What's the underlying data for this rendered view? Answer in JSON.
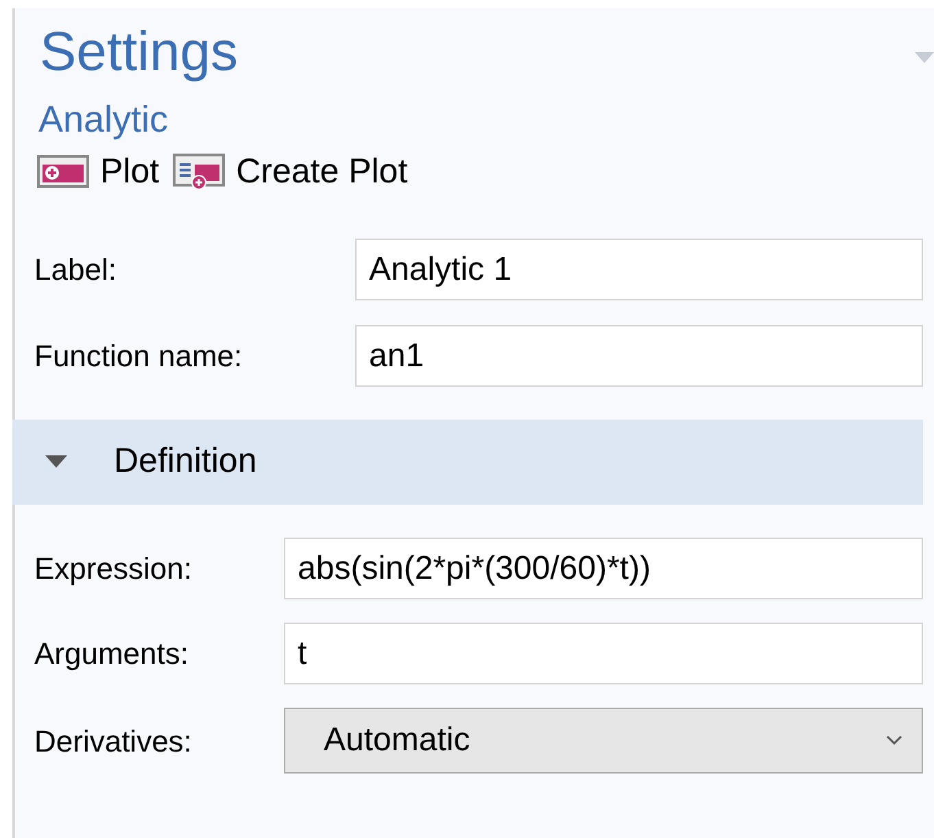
{
  "panel": {
    "title": "Settings",
    "subtitle": "Analytic"
  },
  "toolbar": [
    {
      "label": "Plot",
      "kind": "plot"
    },
    {
      "label": "Create Plot",
      "kind": "create"
    }
  ],
  "fields": [
    {
      "label": "Label:",
      "value": "Analytic 1",
      "kind": "text"
    },
    {
      "label": "Function name:",
      "value": "an1",
      "kind": "text"
    }
  ],
  "section": {
    "title": "Definition",
    "expanded": true,
    "fields": [
      {
        "label": "Expression:",
        "value": "abs(sin(2*pi*(300/60)*t))",
        "kind": "text"
      },
      {
        "label": "Arguments:",
        "value": "t",
        "kind": "text"
      },
      {
        "label": "Derivatives:",
        "value": "Automatic",
        "kind": "select"
      }
    ]
  }
}
